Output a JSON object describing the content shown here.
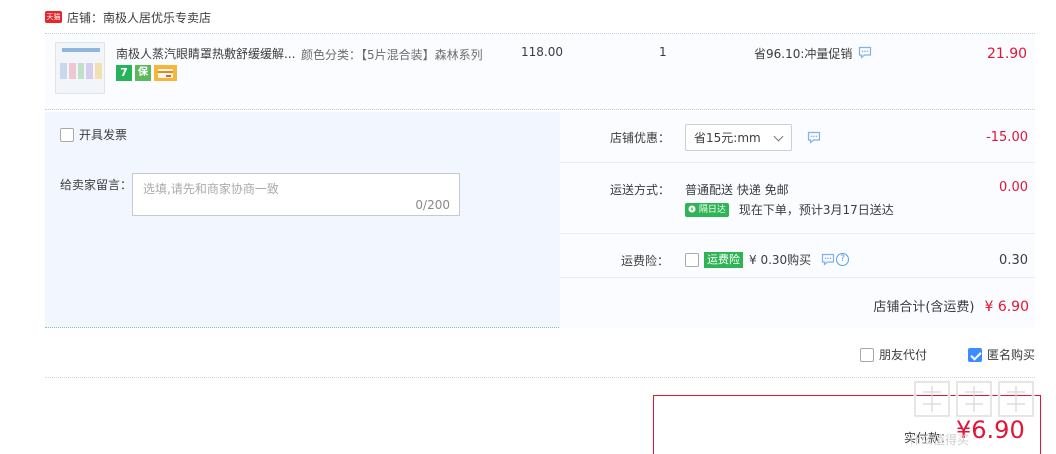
{
  "shop": {
    "badge": "天猫",
    "label": "店铺：南极人居优乐专卖店"
  },
  "item": {
    "title": "南极人蒸汽眼睛罩热敷舒缓缓解...",
    "badges": [
      "7",
      "保"
    ],
    "sku": "颜色分类：【5片混合装】森林系列",
    "price": "118.00",
    "quantity": "1",
    "promo": "省96.10:冲量促销",
    "subtotal": "21.90"
  },
  "invoice": {
    "label": "开具发票"
  },
  "message": {
    "label": "给卖家留言：",
    "placeholder": "选填,请先和商家协商一致",
    "counter": "0/200"
  },
  "coupon": {
    "label": "店铺优惠：",
    "selected": "省15元:mm",
    "amount": "-15.00"
  },
  "shipping": {
    "label": "运送方式：",
    "method": "普通配送 快递 免邮",
    "badge": "隔日达",
    "eta": "现在下单，预计3月17日送达",
    "amount": "0.00"
  },
  "insurance": {
    "label": "运费险：",
    "badge": "运费险",
    "price": "¥ 0.30购买",
    "amount": "0.30"
  },
  "shop_total": {
    "label": "店铺合计(含运费)",
    "amount": "¥ 6.90"
  },
  "options": {
    "friend_pay": "朋友代付",
    "anonymous": "匿名购买",
    "anonymous_checked": true
  },
  "payment": {
    "label": "实付款：",
    "amount": "¥6.90"
  },
  "watermark": {
    "text": "什么值得买"
  },
  "colors": {
    "price_red": "#e31436",
    "accent_blue": "#3d8cff",
    "green_badge": "#2fb455"
  }
}
